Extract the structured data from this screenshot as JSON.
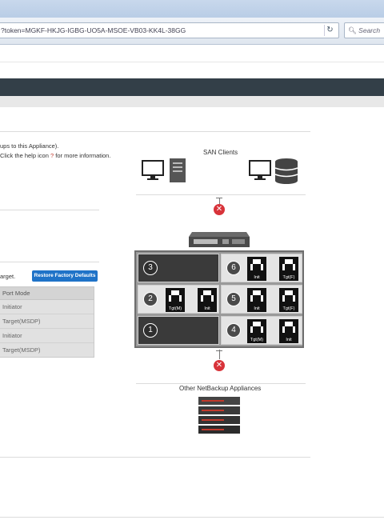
{
  "browser": {
    "url": "?token=MGKF-HKJG-IGBG-UO5A-MSOE-VB03-KK4L-38GG",
    "search_placeholder": "Search",
    "reload_icon": "reload-icon"
  },
  "left_panel": {
    "desc_line1": "ups to this Appliance).",
    "desc_line2_prefix": "Click the help icon",
    "desc_help_glyph": "?",
    "desc_line2_suffix": "for more information.",
    "target_text": "arget.",
    "restore_button": "Restore Factory Defaults",
    "port_table": {
      "header": "Port Mode",
      "rows": [
        "Initiator",
        "Target(MSDP)",
        "Initiator",
        "Target(MSDP)"
      ]
    }
  },
  "diagram": {
    "san_clients_label": "SAN Clients",
    "other_appliances_label": "Other NetBackup Appliances",
    "slots": [
      {
        "number": "3",
        "ports": []
      },
      {
        "number": "6",
        "ports": [
          "Init",
          "Tgt(F)"
        ]
      },
      {
        "number": "2",
        "ports": [
          "Tgt(M)",
          "Init"
        ]
      },
      {
        "number": "5",
        "ports": [
          "Init",
          "Tgt(F)"
        ]
      },
      {
        "number": "1",
        "ports": []
      },
      {
        "number": "4",
        "ports": [
          "Tgt(M)",
          "Init"
        ]
      }
    ],
    "colors": {
      "disconnected": "#d8333a",
      "nav": "#333f48",
      "button": "#1f73c8"
    }
  }
}
